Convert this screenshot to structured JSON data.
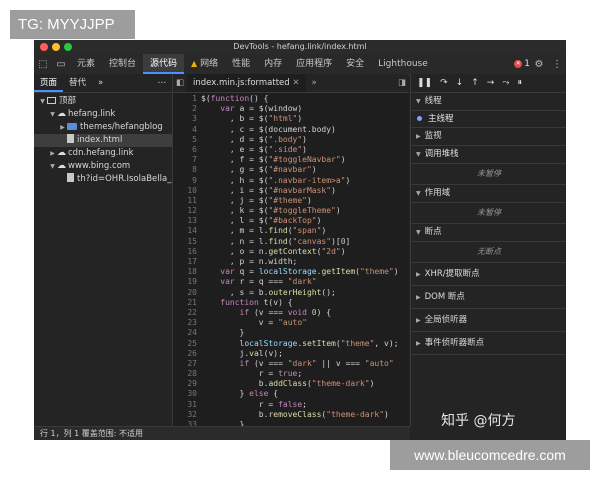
{
  "overlay": {
    "tg": "TG: MYYJJPP",
    "watermark": "www.bleucomcedre.com",
    "zhihu": "知乎 @何方"
  },
  "window": {
    "title": "DevTools - hefang.link/index.html"
  },
  "toolbar": {
    "tabs": [
      "元素",
      "控制台",
      "源代码",
      "网络",
      "性能",
      "内存",
      "应用程序",
      "安全",
      "Lighthouse"
    ],
    "active_tab": "源代码",
    "error_count": "1"
  },
  "left_panel": {
    "tabs": [
      "页面",
      "替代"
    ],
    "more": "»",
    "menu": "⋯",
    "tree": [
      {
        "label": "顶部",
        "indent": 0,
        "kind": "frame",
        "arrow": "▼"
      },
      {
        "label": "hefang.link",
        "indent": 1,
        "kind": "cloud",
        "arrow": "▼"
      },
      {
        "label": "themes/hefangblog",
        "indent": 2,
        "kind": "folder",
        "arrow": "▶"
      },
      {
        "label": "index.html",
        "indent": 2,
        "kind": "file",
        "arrow": "",
        "selected": true
      },
      {
        "label": "cdn.hefang.link",
        "indent": 1,
        "kind": "cloud",
        "arrow": "▶"
      },
      {
        "label": "www.bing.com",
        "indent": 1,
        "kind": "cloud",
        "arrow": "▼"
      },
      {
        "label": "th?id=OHR.IsolaBella_Zh",
        "indent": 2,
        "kind": "file",
        "arrow": ""
      }
    ]
  },
  "editor": {
    "tab": "index.min.js:formatted",
    "more": "»",
    "lines": [
      "$(function() {",
      "    var a = $(window)",
      "      , b = $(\"html\")",
      "      , c = $(document.body)",
      "      , d = $(\".body\")",
      "      , e = $(\".side\")",
      "      , f = $(\"#toggleNavbar\")",
      "      , g = $(\"#navbar\")",
      "      , h = $(\".navbar-item>a\")",
      "      , i = $(\"#navbarMask\")",
      "      , j = $(\"#theme\")",
      "      , k = $(\"#toggleTheme\")",
      "      , l = $(\"#backTop\")",
      "      , m = l.find(\"span\")",
      "      , n = l.find(\"canvas\")[0]",
      "      , o = n.getContext(\"2d\")",
      "      , p = n.width;",
      "    var q = localStorage.getItem(\"theme\")",
      "    var r = q === \"dark\"",
      "      , s = b.outerHeight();",
      "    function t(v) {",
      "        if (v === void 0) {",
      "            v = \"auto\"",
      "        }",
      "        localStorage.setItem(\"theme\", v);",
      "        j.val(v);",
      "        if (v === \"dark\" || v === \"auto\"",
      "            r = true;",
      "            b.addClass(\"theme-dark\")",
      "        } else {",
      "            r = false;",
      "            b.removeClass(\"theme-dark\")",
      "        }",
      "        ..."
    ]
  },
  "right_panel": {
    "threads": {
      "title": "线程",
      "item": "主线程"
    },
    "watch": "监视",
    "callstack": {
      "title": "调用堆栈",
      "empty": "未暂停"
    },
    "scope": {
      "title": "作用域",
      "empty": "未暂停"
    },
    "breakpoints": {
      "title": "断点",
      "empty": "无断点"
    },
    "xhr": "XHR/提取断点",
    "dom": "DOM 断点",
    "global": "全局侦听器",
    "event": "事件侦听器断点"
  },
  "statusbar": {
    "text": "行 1，列 1  覆盖范围: 不适用"
  }
}
